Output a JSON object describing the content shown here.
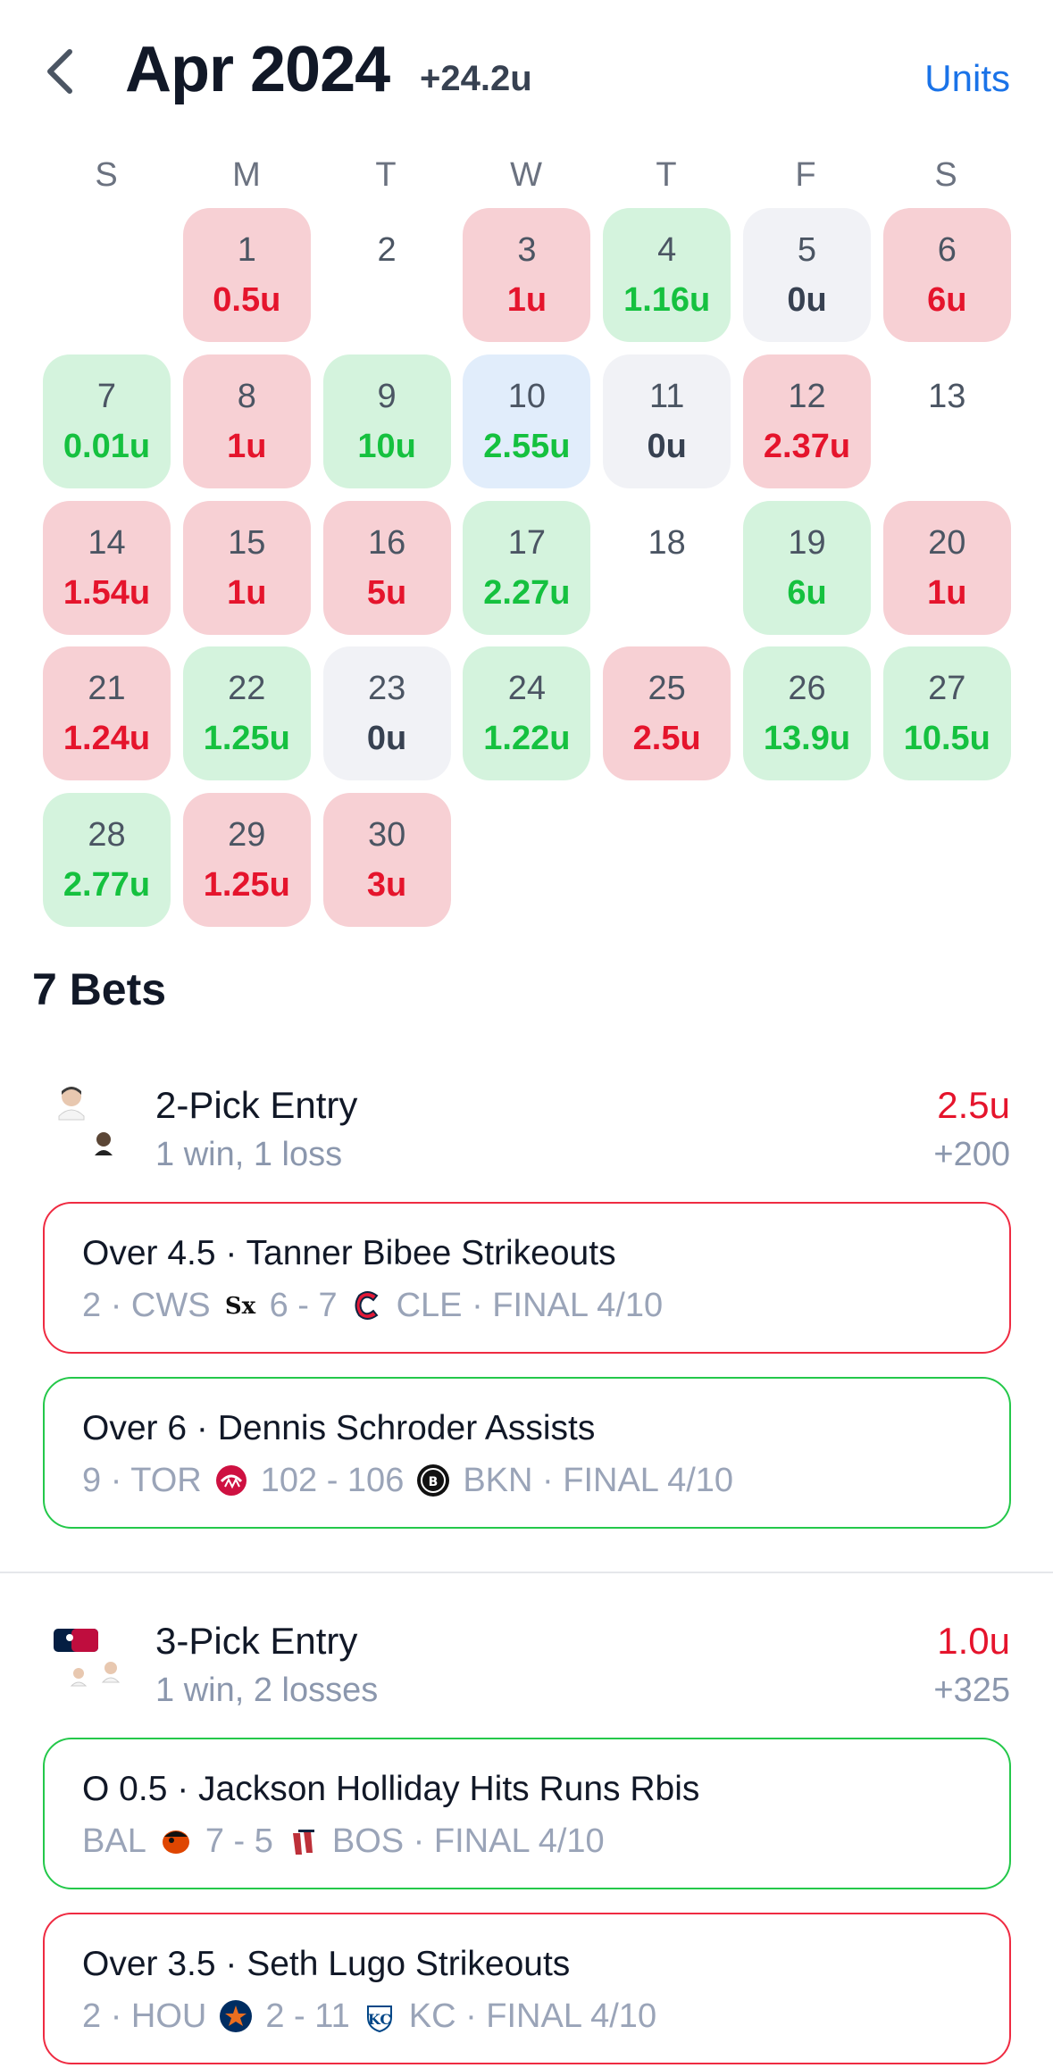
{
  "header": {
    "title": "Apr 2024",
    "total": "+24.2u",
    "units_label": "Units"
  },
  "weekdays": [
    "S",
    "M",
    "T",
    "W",
    "T",
    "F",
    "S"
  ],
  "days": [
    {
      "num": "1",
      "val": "0.5u",
      "status": "loss"
    },
    {
      "num": "2",
      "val": "",
      "status": "none"
    },
    {
      "num": "3",
      "val": "1u",
      "status": "loss"
    },
    {
      "num": "4",
      "val": "1.16u",
      "status": "win"
    },
    {
      "num": "5",
      "val": "0u",
      "status": "push"
    },
    {
      "num": "6",
      "val": "6u",
      "status": "loss"
    },
    {
      "num": "7",
      "val": "0.01u",
      "status": "win"
    },
    {
      "num": "8",
      "val": "1u",
      "status": "loss"
    },
    {
      "num": "9",
      "val": "10u",
      "status": "win"
    },
    {
      "num": "10",
      "val": "2.55u",
      "status": "today"
    },
    {
      "num": "11",
      "val": "0u",
      "status": "push"
    },
    {
      "num": "12",
      "val": "2.37u",
      "status": "loss"
    },
    {
      "num": "13",
      "val": "",
      "status": "none"
    },
    {
      "num": "14",
      "val": "1.54u",
      "status": "loss"
    },
    {
      "num": "15",
      "val": "1u",
      "status": "loss"
    },
    {
      "num": "16",
      "val": "5u",
      "status": "loss"
    },
    {
      "num": "17",
      "val": "2.27u",
      "status": "win"
    },
    {
      "num": "18",
      "val": "",
      "status": "none"
    },
    {
      "num": "19",
      "val": "6u",
      "status": "win"
    },
    {
      "num": "20",
      "val": "1u",
      "status": "loss"
    },
    {
      "num": "21",
      "val": "1.24u",
      "status": "loss"
    },
    {
      "num": "22",
      "val": "1.25u",
      "status": "win"
    },
    {
      "num": "23",
      "val": "0u",
      "status": "push"
    },
    {
      "num": "24",
      "val": "1.22u",
      "status": "win"
    },
    {
      "num": "25",
      "val": "2.5u",
      "status": "loss"
    },
    {
      "num": "26",
      "val": "13.9u",
      "status": "win"
    },
    {
      "num": "27",
      "val": "10.5u",
      "status": "win"
    },
    {
      "num": "28",
      "val": "2.77u",
      "status": "win"
    },
    {
      "num": "29",
      "val": "1.25u",
      "status": "loss"
    },
    {
      "num": "30",
      "val": "3u",
      "status": "loss"
    }
  ],
  "bets_count": "7 Bets",
  "entries": [
    {
      "title": "2-Pick Entry",
      "record": "1 win, 1 loss",
      "amount": "2.5u",
      "odds": "+200",
      "picks": [
        {
          "title": "Over 4.5 · Tanner Bibee Strikeouts",
          "prefix": "2 · CWS",
          "score": "6 - 7",
          "suffix": "CLE · FINAL 4/10",
          "result": "lost"
        },
        {
          "title": "Over 6 · Dennis Schroder Assists",
          "prefix": "9 · TOR",
          "score": "102 - 106",
          "suffix": "BKN · FINAL 4/10",
          "result": "won"
        }
      ]
    },
    {
      "title": "3-Pick Entry",
      "record": "1 win, 2 losses",
      "amount": "1.0u",
      "odds": "+325",
      "picks": [
        {
          "title": "O 0.5 · Jackson Holliday Hits Runs Rbis",
          "prefix": "BAL",
          "score": "7 - 5",
          "suffix": "BOS · FINAL 4/10",
          "result": "won"
        },
        {
          "title": "Over 3.5 · Seth Lugo Strikeouts",
          "prefix": "2 · HOU",
          "score": "2 - 11",
          "suffix": "KC · FINAL 4/10",
          "result": "lost"
        }
      ]
    }
  ],
  "colors": {
    "loss": "#e5142c",
    "win": "#15c13f",
    "accent": "#1a73e8"
  }
}
